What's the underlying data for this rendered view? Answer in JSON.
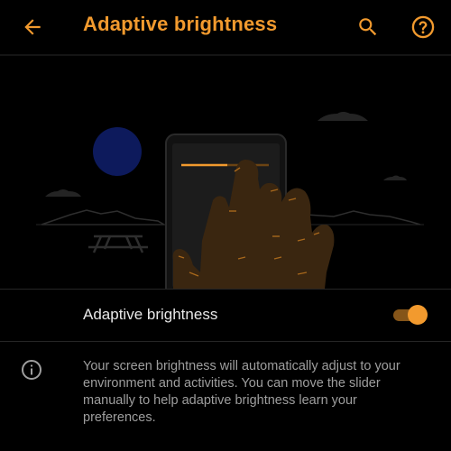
{
  "app_bar": {
    "title": "Adaptive brightness",
    "back_icon": "arrow-back-icon",
    "search_icon": "search-icon",
    "help_icon": "help-icon"
  },
  "illustration": {
    "description_icons": [
      "moon-icon",
      "phone-icon",
      "hand-icon",
      "picnic-table-icon",
      "mountains-icon",
      "cloud-icon"
    ]
  },
  "setting": {
    "label": "Adaptive brightness",
    "enabled": true
  },
  "info": {
    "icon": "info-icon",
    "text": "Your screen brightness will automatically adjust to your environment and activities. You can move the slider manually to help adaptive brightness learn your preferences."
  },
  "colors": {
    "accent": "#f29a2e",
    "accent_dark": "#a8681c",
    "background": "#000000",
    "moon": "#0d1a5c",
    "hand": "#3a2610",
    "phone": "#1a1a1a",
    "scenery": "#2a2a2a"
  }
}
